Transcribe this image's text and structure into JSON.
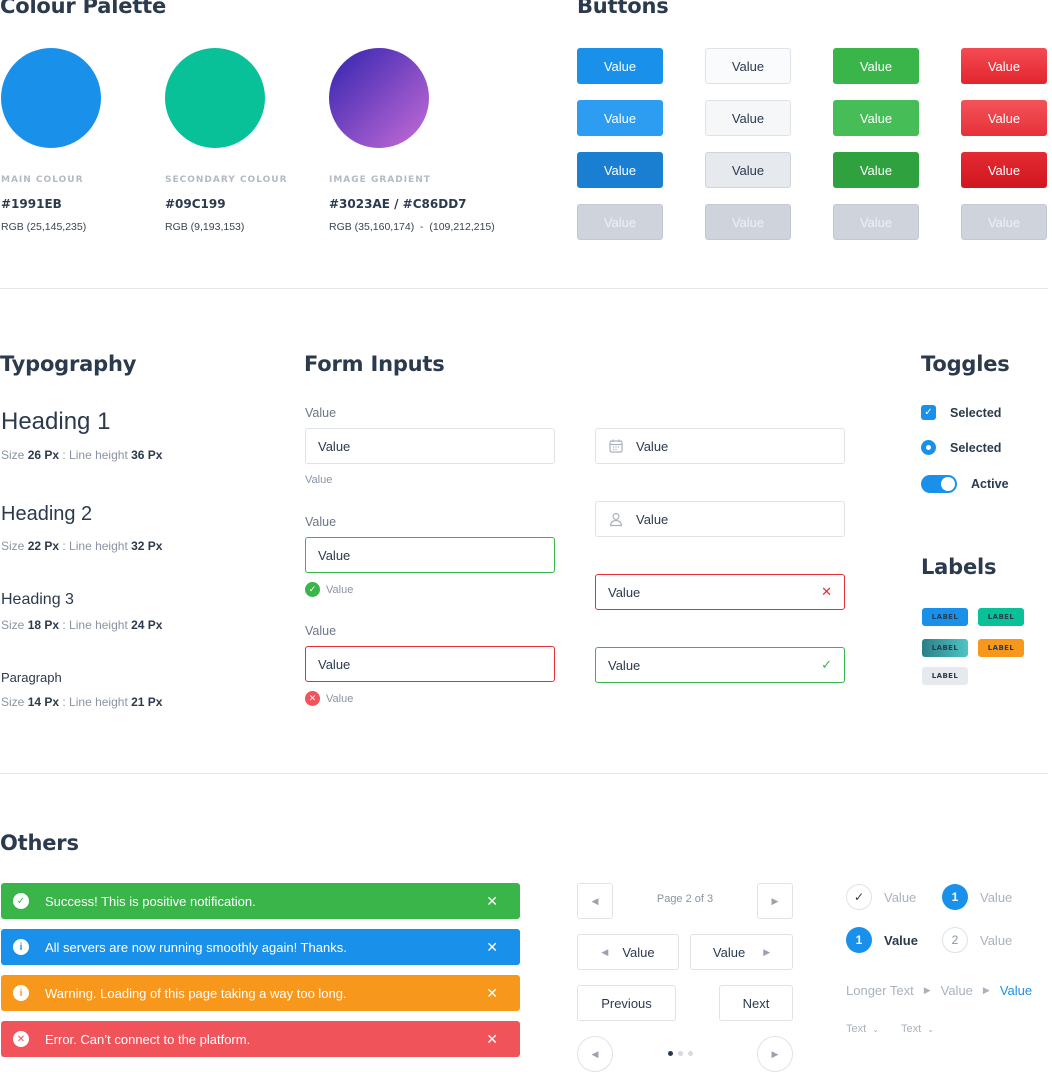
{
  "palette": {
    "title": "Colour Palette",
    "colors": [
      {
        "caption": "MAIN COLOUR",
        "hex": "#1991EB",
        "rgb": "RGB (25,145,235)"
      },
      {
        "caption": "SECONDARY COLOUR",
        "hex": "#09C199",
        "rgb": "RGB (9,193,153)"
      },
      {
        "caption": "IMAGE GRADIENT",
        "hex": "#3023AE / #C86DD7",
        "rgb": "RGB (35,160,174)  -  (109,212,215)"
      }
    ],
    "swatch_colors": [
      "#1991eb",
      "#09c199",
      "#3023ae",
      "#c86dd7"
    ]
  },
  "buttons": {
    "title": "Buttons",
    "label": "Value"
  },
  "typography": {
    "title": "Typography",
    "items": [
      {
        "name": "Heading 1",
        "size": "26 Px",
        "line": "36 Px"
      },
      {
        "name": "Heading 2",
        "size": "22 Px",
        "line": "32 Px"
      },
      {
        "name": "Heading 3",
        "size": "18 Px",
        "line": "24 Px"
      },
      {
        "name": "Paragraph",
        "size": "14 Px",
        "line": "21 Px"
      }
    ],
    "size_prefix": "Size",
    "line_prefix": ": Line height"
  },
  "form": {
    "title": "Form Inputs",
    "label": "Value",
    "value": "Value",
    "hint": "Value"
  },
  "toggles": {
    "title": "Toggles",
    "checkbox_label": "Selected",
    "radio_label": "Selected",
    "switch_label": "Active"
  },
  "labels": {
    "title": "Labels",
    "text": "LABEL"
  },
  "others": {
    "title": "Others",
    "alerts": [
      {
        "text": "Success! This is positive notification.",
        "color": "#39b54a",
        "icon": "check-icon"
      },
      {
        "text": "All servers are now running smoothly again! Thanks.",
        "color": "#1991eb",
        "icon": "info-icon"
      },
      {
        "text": "Warning. Loading of this page taking a way too long.",
        "color": "#f7981c",
        "icon": "info-icon"
      },
      {
        "text": "Error. Can’t connect to the platform.",
        "color": "#f1535b",
        "icon": "error-icon"
      }
    ],
    "pagination": {
      "page_text": "Page 2 of 3",
      "prev_value": "Value",
      "next_value": "Value",
      "previous": "Previous",
      "next": "Next"
    },
    "steps": {
      "value": "Value",
      "num1": "1",
      "num2": "2"
    },
    "breadcrumb": [
      "Longer Text",
      "Value",
      "Value"
    ],
    "dropdowns": [
      "Text",
      "Text"
    ]
  }
}
